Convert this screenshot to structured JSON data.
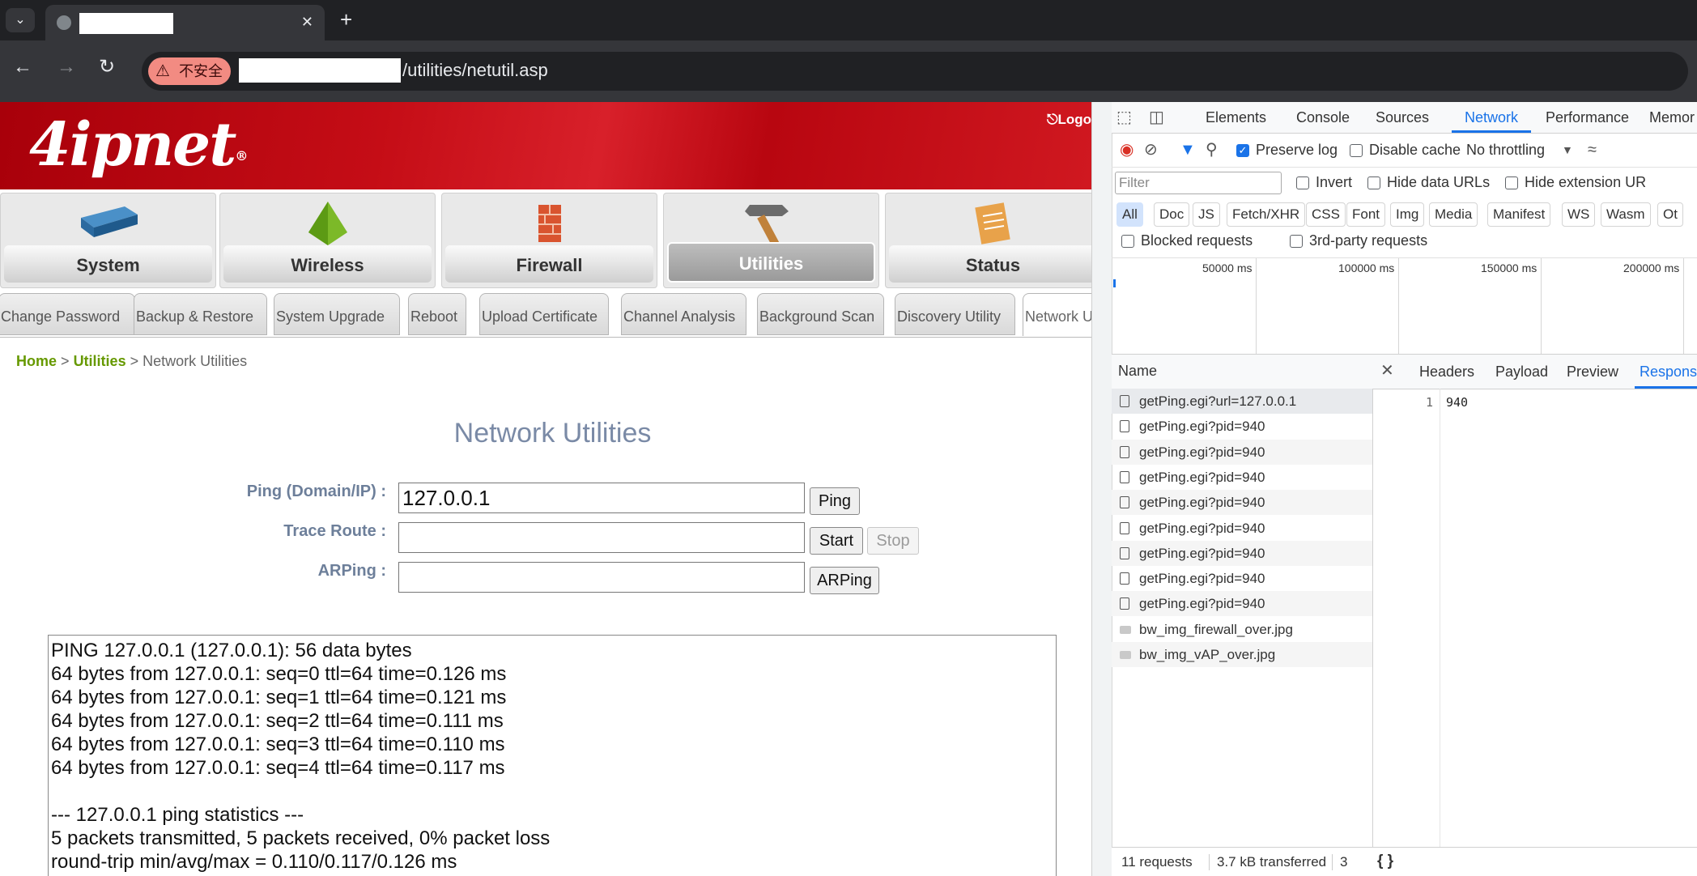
{
  "browser": {
    "new_tab_glyph": "+",
    "url_path": "/utilities/netutil.asp",
    "security_label": "不安全"
  },
  "page": {
    "logo": "4ipnet",
    "logo_mark": "®",
    "logout": "Logo",
    "nav": [
      "System",
      "Wireless",
      "Firewall",
      "Utilities",
      "Status"
    ],
    "subtabs": [
      "Change Password",
      "Backup & Restore",
      "System Upgrade",
      "Reboot",
      "Upload Certificate",
      "Channel Analysis",
      "Background Scan",
      "Discovery Utility",
      "Network U"
    ],
    "breadcrumb": {
      "home": "Home",
      "sep": ">",
      "section": "Utilities",
      "current": "Network Utilities"
    },
    "title": "Network Utilities",
    "form": {
      "ping_label": "Ping (Domain/IP) :",
      "ping_value": "127.0.0.1",
      "ping_btn": "Ping",
      "trace_label": "Trace Route :",
      "trace_value": "",
      "start_btn": "Start",
      "stop_btn": "Stop",
      "arping_label": "ARPing :",
      "arping_value": "",
      "arping_btn": "ARPing"
    },
    "output": [
      "PING 127.0.0.1 (127.0.0.1): 56 data bytes",
      "64 bytes from 127.0.0.1: seq=0 ttl=64 time=0.126 ms",
      "64 bytes from 127.0.0.1: seq=1 ttl=64 time=0.121 ms",
      "64 bytes from 127.0.0.1: seq=2 ttl=64 time=0.111 ms",
      "64 bytes from 127.0.0.1: seq=3 ttl=64 time=0.110 ms",
      "64 bytes from 127.0.0.1: seq=4 ttl=64 time=0.117 ms",
      "",
      "--- 127.0.0.1 ping statistics ---",
      "5 packets transmitted, 5 packets received, 0% packet loss",
      "round-trip min/avg/max = 0.110/0.117/0.126 ms"
    ]
  },
  "devtools": {
    "tabs": [
      "Elements",
      "Console",
      "Sources",
      "Network",
      "Performance",
      "Memor"
    ],
    "preserve_log": "Preserve log",
    "disable_cache": "Disable cache",
    "throttling": "No throttling",
    "filter_placeholder": "Filter",
    "invert": "Invert",
    "hide_data_urls": "Hide data URLs",
    "hide_ext": "Hide extension UR",
    "chips": [
      "All",
      "Doc",
      "JS",
      "Fetch/XHR",
      "CSS",
      "Font",
      "Img",
      "Media",
      "Manifest",
      "WS",
      "Wasm",
      "Ot"
    ],
    "blocked": "Blocked requests",
    "third_party": "3rd-party requests",
    "timeline": [
      "50000 ms",
      "100000 ms",
      "150000 ms",
      "200000 ms"
    ],
    "name_header": "Name",
    "detail_tabs": [
      "Headers",
      "Payload",
      "Preview",
      "Respons"
    ],
    "requests": [
      {
        "name": "getPing.egi?url=127.0.0.1",
        "kind": "doc"
      },
      {
        "name": "getPing.egi?pid=940",
        "kind": "doc"
      },
      {
        "name": "getPing.egi?pid=940",
        "kind": "doc"
      },
      {
        "name": "getPing.egi?pid=940",
        "kind": "doc"
      },
      {
        "name": "getPing.egi?pid=940",
        "kind": "doc"
      },
      {
        "name": "getPing.egi?pid=940",
        "kind": "doc"
      },
      {
        "name": "getPing.egi?pid=940",
        "kind": "doc"
      },
      {
        "name": "getPing.egi?pid=940",
        "kind": "doc"
      },
      {
        "name": "getPing.egi?pid=940",
        "kind": "doc"
      },
      {
        "name": "bw_img_firewall_over.jpg",
        "kind": "img"
      },
      {
        "name": "bw_img_vAP_over.jpg",
        "kind": "img"
      }
    ],
    "response_line_no": "1",
    "response_text": "940",
    "footer_requests": "11 requests",
    "footer_transferred": "3.7 kB transferred",
    "footer_more": "3",
    "footer_braces": "{ }",
    "accent": "#1a73e8"
  }
}
